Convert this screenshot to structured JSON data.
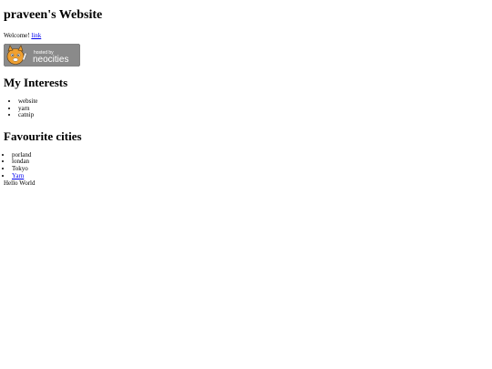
{
  "page": {
    "title": "praveen's Website",
    "welcome_text": "Welcome! ",
    "welcome_link": "link",
    "badge": {
      "line1": "hosted by",
      "line2": "neocities",
      "colors": {
        "background": "#8a8a8a",
        "text": "#ffffff",
        "mascot": "#f0a030"
      }
    },
    "interests": {
      "heading": "My Interests",
      "items": [
        "website",
        "yarn",
        "catnip"
      ]
    },
    "cities": {
      "heading": "Favourite cities",
      "items": [
        {
          "label": "porland",
          "link": false
        },
        {
          "label": "londan",
          "link": false
        },
        {
          "label": "Tokyo",
          "link": false
        },
        {
          "label": "Yarn",
          "link": true
        }
      ]
    },
    "footer_text": "Hello World"
  }
}
